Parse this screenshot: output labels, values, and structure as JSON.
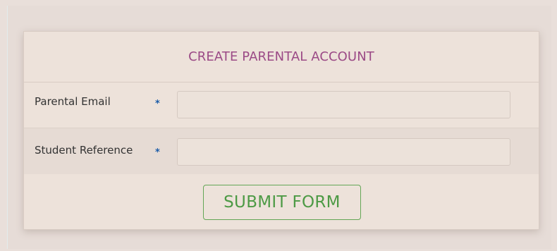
{
  "form": {
    "title": "CREATE PARENTAL ACCOUNT",
    "fields": [
      {
        "label": "Parental Email",
        "required_marker": "*",
        "value": "",
        "placeholder": ""
      },
      {
        "label": "Student Reference",
        "required_marker": "*",
        "value": "",
        "placeholder": ""
      }
    ],
    "submit_label": "SUBMIT FORM"
  },
  "colors": {
    "page_background": "#e9dfda",
    "panel_background": "#ede2da",
    "title": "#9b4a86",
    "required_marker": "#1a5ba8",
    "submit_accent": "#4d9a45"
  }
}
